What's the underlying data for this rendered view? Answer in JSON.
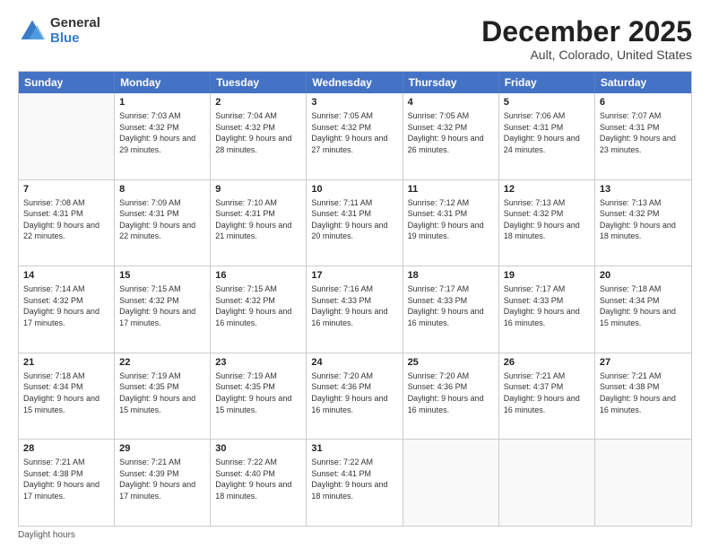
{
  "logo": {
    "general": "General",
    "blue": "Blue"
  },
  "title": "December 2025",
  "subtitle": "Ault, Colorado, United States",
  "days_of_week": [
    "Sunday",
    "Monday",
    "Tuesday",
    "Wednesday",
    "Thursday",
    "Friday",
    "Saturday"
  ],
  "footer": "Daylight hours",
  "weeks": [
    [
      {
        "day": "",
        "sunrise": "",
        "sunset": "",
        "daylight": "",
        "empty": true
      },
      {
        "day": "1",
        "sunrise": "Sunrise: 7:03 AM",
        "sunset": "Sunset: 4:32 PM",
        "daylight": "Daylight: 9 hours and 29 minutes."
      },
      {
        "day": "2",
        "sunrise": "Sunrise: 7:04 AM",
        "sunset": "Sunset: 4:32 PM",
        "daylight": "Daylight: 9 hours and 28 minutes."
      },
      {
        "day": "3",
        "sunrise": "Sunrise: 7:05 AM",
        "sunset": "Sunset: 4:32 PM",
        "daylight": "Daylight: 9 hours and 27 minutes."
      },
      {
        "day": "4",
        "sunrise": "Sunrise: 7:05 AM",
        "sunset": "Sunset: 4:32 PM",
        "daylight": "Daylight: 9 hours and 26 minutes."
      },
      {
        "day": "5",
        "sunrise": "Sunrise: 7:06 AM",
        "sunset": "Sunset: 4:31 PM",
        "daylight": "Daylight: 9 hours and 24 minutes."
      },
      {
        "day": "6",
        "sunrise": "Sunrise: 7:07 AM",
        "sunset": "Sunset: 4:31 PM",
        "daylight": "Daylight: 9 hours and 23 minutes."
      }
    ],
    [
      {
        "day": "7",
        "sunrise": "Sunrise: 7:08 AM",
        "sunset": "Sunset: 4:31 PM",
        "daylight": "Daylight: 9 hours and 22 minutes."
      },
      {
        "day": "8",
        "sunrise": "Sunrise: 7:09 AM",
        "sunset": "Sunset: 4:31 PM",
        "daylight": "Daylight: 9 hours and 22 minutes."
      },
      {
        "day": "9",
        "sunrise": "Sunrise: 7:10 AM",
        "sunset": "Sunset: 4:31 PM",
        "daylight": "Daylight: 9 hours and 21 minutes."
      },
      {
        "day": "10",
        "sunrise": "Sunrise: 7:11 AM",
        "sunset": "Sunset: 4:31 PM",
        "daylight": "Daylight: 9 hours and 20 minutes."
      },
      {
        "day": "11",
        "sunrise": "Sunrise: 7:12 AM",
        "sunset": "Sunset: 4:31 PM",
        "daylight": "Daylight: 9 hours and 19 minutes."
      },
      {
        "day": "12",
        "sunrise": "Sunrise: 7:13 AM",
        "sunset": "Sunset: 4:32 PM",
        "daylight": "Daylight: 9 hours and 18 minutes."
      },
      {
        "day": "13",
        "sunrise": "Sunrise: 7:13 AM",
        "sunset": "Sunset: 4:32 PM",
        "daylight": "Daylight: 9 hours and 18 minutes."
      }
    ],
    [
      {
        "day": "14",
        "sunrise": "Sunrise: 7:14 AM",
        "sunset": "Sunset: 4:32 PM",
        "daylight": "Daylight: 9 hours and 17 minutes."
      },
      {
        "day": "15",
        "sunrise": "Sunrise: 7:15 AM",
        "sunset": "Sunset: 4:32 PM",
        "daylight": "Daylight: 9 hours and 17 minutes."
      },
      {
        "day": "16",
        "sunrise": "Sunrise: 7:15 AM",
        "sunset": "Sunset: 4:32 PM",
        "daylight": "Daylight: 9 hours and 16 minutes."
      },
      {
        "day": "17",
        "sunrise": "Sunrise: 7:16 AM",
        "sunset": "Sunset: 4:33 PM",
        "daylight": "Daylight: 9 hours and 16 minutes."
      },
      {
        "day": "18",
        "sunrise": "Sunrise: 7:17 AM",
        "sunset": "Sunset: 4:33 PM",
        "daylight": "Daylight: 9 hours and 16 minutes."
      },
      {
        "day": "19",
        "sunrise": "Sunrise: 7:17 AM",
        "sunset": "Sunset: 4:33 PM",
        "daylight": "Daylight: 9 hours and 16 minutes."
      },
      {
        "day": "20",
        "sunrise": "Sunrise: 7:18 AM",
        "sunset": "Sunset: 4:34 PM",
        "daylight": "Daylight: 9 hours and 15 minutes."
      }
    ],
    [
      {
        "day": "21",
        "sunrise": "Sunrise: 7:18 AM",
        "sunset": "Sunset: 4:34 PM",
        "daylight": "Daylight: 9 hours and 15 minutes."
      },
      {
        "day": "22",
        "sunrise": "Sunrise: 7:19 AM",
        "sunset": "Sunset: 4:35 PM",
        "daylight": "Daylight: 9 hours and 15 minutes."
      },
      {
        "day": "23",
        "sunrise": "Sunrise: 7:19 AM",
        "sunset": "Sunset: 4:35 PM",
        "daylight": "Daylight: 9 hours and 15 minutes."
      },
      {
        "day": "24",
        "sunrise": "Sunrise: 7:20 AM",
        "sunset": "Sunset: 4:36 PM",
        "daylight": "Daylight: 9 hours and 16 minutes."
      },
      {
        "day": "25",
        "sunrise": "Sunrise: 7:20 AM",
        "sunset": "Sunset: 4:36 PM",
        "daylight": "Daylight: 9 hours and 16 minutes."
      },
      {
        "day": "26",
        "sunrise": "Sunrise: 7:21 AM",
        "sunset": "Sunset: 4:37 PM",
        "daylight": "Daylight: 9 hours and 16 minutes."
      },
      {
        "day": "27",
        "sunrise": "Sunrise: 7:21 AM",
        "sunset": "Sunset: 4:38 PM",
        "daylight": "Daylight: 9 hours and 16 minutes."
      }
    ],
    [
      {
        "day": "28",
        "sunrise": "Sunrise: 7:21 AM",
        "sunset": "Sunset: 4:38 PM",
        "daylight": "Daylight: 9 hours and 17 minutes."
      },
      {
        "day": "29",
        "sunrise": "Sunrise: 7:21 AM",
        "sunset": "Sunset: 4:39 PM",
        "daylight": "Daylight: 9 hours and 17 minutes."
      },
      {
        "day": "30",
        "sunrise": "Sunrise: 7:22 AM",
        "sunset": "Sunset: 4:40 PM",
        "daylight": "Daylight: 9 hours and 18 minutes."
      },
      {
        "day": "31",
        "sunrise": "Sunrise: 7:22 AM",
        "sunset": "Sunset: 4:41 PM",
        "daylight": "Daylight: 9 hours and 18 minutes."
      },
      {
        "day": "",
        "sunrise": "",
        "sunset": "",
        "daylight": "",
        "empty": true
      },
      {
        "day": "",
        "sunrise": "",
        "sunset": "",
        "daylight": "",
        "empty": true
      },
      {
        "day": "",
        "sunrise": "",
        "sunset": "",
        "daylight": "",
        "empty": true
      }
    ]
  ]
}
